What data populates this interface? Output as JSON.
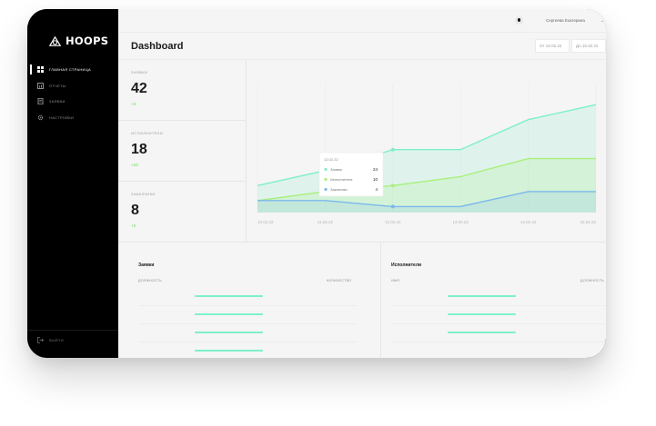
{
  "app": {
    "logo_text": "HOOPS"
  },
  "sidebar": {
    "items": [
      {
        "label": "главная страница",
        "icon": "dashboard-icon",
        "active": true
      },
      {
        "label": "отчеты",
        "icon": "reports-icon",
        "active": false
      },
      {
        "label": "заявки",
        "icon": "requests-icon",
        "active": false
      },
      {
        "label": "настройки",
        "icon": "settings-icon",
        "active": false
      }
    ],
    "logout_label": "выйти"
  },
  "topbar": {
    "user_name": "Сергеева Екатерина"
  },
  "header": {
    "title": "Dashboard",
    "date_from": "От 10.02.22",
    "date_to": "До 15.02.22"
  },
  "stats": [
    {
      "label": "заявки",
      "value": "42",
      "delta": "+4"
    },
    {
      "label": "исполнители",
      "value": "18",
      "delta": "+10"
    },
    {
      "label": "заказчики",
      "value": "8",
      "delta": "+2"
    }
  ],
  "chart_data": {
    "type": "area",
    "categories": [
      "10.02.22",
      "11.02.22",
      "12.02.22",
      "13.02.22",
      "14.02.22",
      "15.02.22"
    ],
    "y_ticks": [
      "40",
      "30",
      "20",
      "10",
      "0"
    ],
    "ylim": [
      0,
      40
    ],
    "series": [
      {
        "name": "Заявки",
        "color": "#7ef0c8",
        "values": [
          [
            0,
            9
          ],
          [
            1,
            14
          ],
          [
            2,
            21
          ],
          [
            3,
            21
          ],
          [
            4,
            31
          ],
          [
            5,
            36
          ]
        ]
      },
      {
        "name": "Исполнители",
        "color": "#a8f07a",
        "values": [
          [
            0,
            4
          ],
          [
            1,
            7
          ],
          [
            2,
            9
          ],
          [
            3,
            12
          ],
          [
            4,
            18
          ],
          [
            5,
            18
          ]
        ]
      },
      {
        "name": "Заказчики",
        "color": "#7ab8ec",
        "values": [
          [
            0,
            4
          ],
          [
            1,
            4
          ],
          [
            2,
            2
          ],
          [
            3,
            2
          ],
          [
            4,
            7
          ],
          [
            5,
            7
          ]
        ]
      }
    ],
    "tooltip": {
      "date": "12.02.22",
      "rows": [
        {
          "name": "Заявки",
          "value": "24"
        },
        {
          "name": "Исполнители",
          "value": "10"
        },
        {
          "name": "Заказчики",
          "value": "4"
        }
      ]
    },
    "grid": true
  },
  "tables": [
    {
      "title": "Заявки",
      "col1": "должность",
      "col2": "количество",
      "bars": [
        0.75,
        0.75,
        0.75,
        0.75
      ]
    },
    {
      "title": "Исполнители",
      "col1": "имя",
      "col2": "должность",
      "bars": [
        0.75,
        0.75,
        0.75
      ]
    }
  ],
  "colors": {
    "accent_mint": "#7ef0c8",
    "accent_green": "#a8f07a",
    "accent_blue": "#7ab8ec",
    "delta": "#5ed44f"
  }
}
